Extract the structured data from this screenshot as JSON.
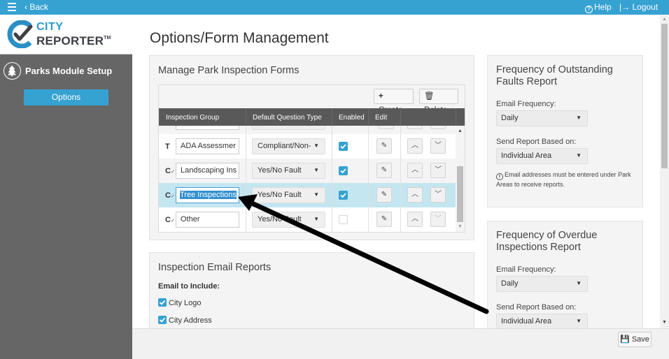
{
  "topbar": {
    "back_label": "Back",
    "help_label": "Help",
    "logout_label": "Logout"
  },
  "sidebar": {
    "logo_line1": "CITY",
    "logo_line2": "REPORTER",
    "logo_tm": "TM",
    "module_title": "Parks Module Setup",
    "options_label": "Options"
  },
  "page": {
    "title": "Options/Form Management"
  },
  "forms": {
    "title": "Manage Park Inspection Forms",
    "create_label": "Create",
    "delete_label": "Delete",
    "columns": [
      "Inspection Group",
      "Default Question Type",
      "Enabled",
      "Edit"
    ],
    "rows": [
      {
        "type_icon": "T",
        "name": "ADA Assessmer",
        "question_type": "Compliant/Non-",
        "enabled": true,
        "selected": false,
        "down_enabled": true
      },
      {
        "type_icon": "C",
        "name": "Landscaping Ins",
        "question_type": "Yes/No Fault",
        "enabled": true,
        "selected": false,
        "down_enabled": true
      },
      {
        "type_icon": "C",
        "name": "Tree Inspections",
        "question_type": "Yes/No Fault",
        "enabled": true,
        "selected": true,
        "down_enabled": true
      },
      {
        "type_icon": "C",
        "name": "Other",
        "question_type": "Yes/No Fault",
        "enabled": false,
        "selected": false,
        "down_enabled": false
      }
    ]
  },
  "email_reports": {
    "title": "Inspection Email Reports",
    "include_label": "Email to Include:",
    "options": [
      {
        "label": "City Logo",
        "checked": true
      },
      {
        "label": "City Address",
        "checked": true
      }
    ]
  },
  "fault_report": {
    "title": "Frequency of Outstanding Faults Report",
    "frequency_label": "Email Frequency:",
    "frequency_value": "Daily",
    "based_on_label": "Send Report Based on:",
    "based_on_value": "Individual Area",
    "note": "Email addresses must be entered under Park Areas to receive reports."
  },
  "overdue_report": {
    "title": "Frequency of Overdue Inspections Report",
    "frequency_label": "Email Frequency:",
    "frequency_value": "Daily",
    "based_on_label": "Send Report Based on:",
    "based_on_value": "Individual Area"
  },
  "footer": {
    "save_label": "Save"
  },
  "colors": {
    "accent": "#36a2d2",
    "sidebar": "#666666",
    "header_dark": "#595959",
    "selected_row": "#c4e6f1"
  }
}
